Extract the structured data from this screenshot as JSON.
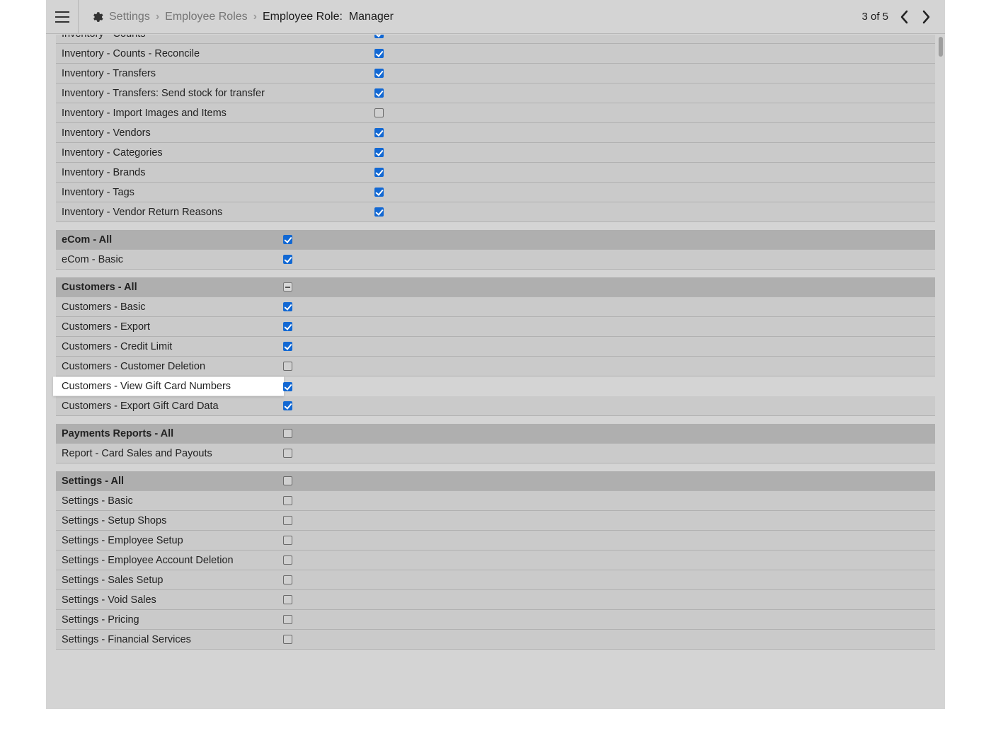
{
  "header": {
    "crumbs": {
      "settings": "Settings",
      "employeeRoles": "Employee Roles",
      "currentPrefix": "Employee Role:",
      "currentValue": "Manager"
    },
    "pager": "3 of 5"
  },
  "groupsInventoryTop": [
    {
      "label": "Inventory - Counts",
      "state": "checked"
    },
    {
      "label": "Inventory - Counts - Reconcile",
      "state": "checked"
    },
    {
      "label": "Inventory - Transfers",
      "state": "checked"
    },
    {
      "label": "Inventory - Transfers: Send stock for transfer",
      "state": "checked"
    },
    {
      "label": "Inventory - Import Images and Items",
      "state": "unchecked"
    },
    {
      "label": "Inventory - Vendors",
      "state": "checked"
    },
    {
      "label": "Inventory - Categories",
      "state": "checked"
    },
    {
      "label": "Inventory - Brands",
      "state": "checked"
    },
    {
      "label": "Inventory - Tags",
      "state": "checked"
    },
    {
      "label": "Inventory - Vendor Return Reasons",
      "state": "checked"
    }
  ],
  "ecomHeader": {
    "label": "eCom - All",
    "state": "checked"
  },
  "ecomRows": [
    {
      "label": "eCom - Basic",
      "state": "checked"
    }
  ],
  "customersHeader": {
    "label": "Customers - All",
    "state": "indeterminate"
  },
  "customersRows": [
    {
      "label": "Customers - Basic",
      "state": "checked"
    },
    {
      "label": "Customers - Export",
      "state": "checked"
    },
    {
      "label": "Customers - Credit Limit",
      "state": "checked"
    },
    {
      "label": "Customers - Customer Deletion",
      "state": "unchecked"
    },
    {
      "label": "Customers - View Gift Card Numbers",
      "state": "checked",
      "highlight": true
    },
    {
      "label": "Customers - Export Gift Card Data",
      "state": "checked"
    }
  ],
  "paymentsHeader": {
    "label": "Payments Reports - All",
    "state": "unchecked"
  },
  "paymentsRows": [
    {
      "label": "Report - Card Sales and Payouts",
      "state": "unchecked"
    }
  ],
  "settingsHeader": {
    "label": "Settings - All",
    "state": "unchecked"
  },
  "settingsRows": [
    {
      "label": "Settings - Basic",
      "state": "unchecked"
    },
    {
      "label": "Settings - Setup Shops",
      "state": "unchecked"
    },
    {
      "label": "Settings - Employee Setup",
      "state": "unchecked"
    },
    {
      "label": "Settings - Employee Account Deletion",
      "state": "unchecked"
    },
    {
      "label": "Settings - Sales Setup",
      "state": "unchecked"
    },
    {
      "label": "Settings - Void Sales",
      "state": "unchecked"
    },
    {
      "label": "Settings - Pricing",
      "state": "unchecked"
    },
    {
      "label": "Settings - Financial Services",
      "state": "unchecked"
    }
  ]
}
